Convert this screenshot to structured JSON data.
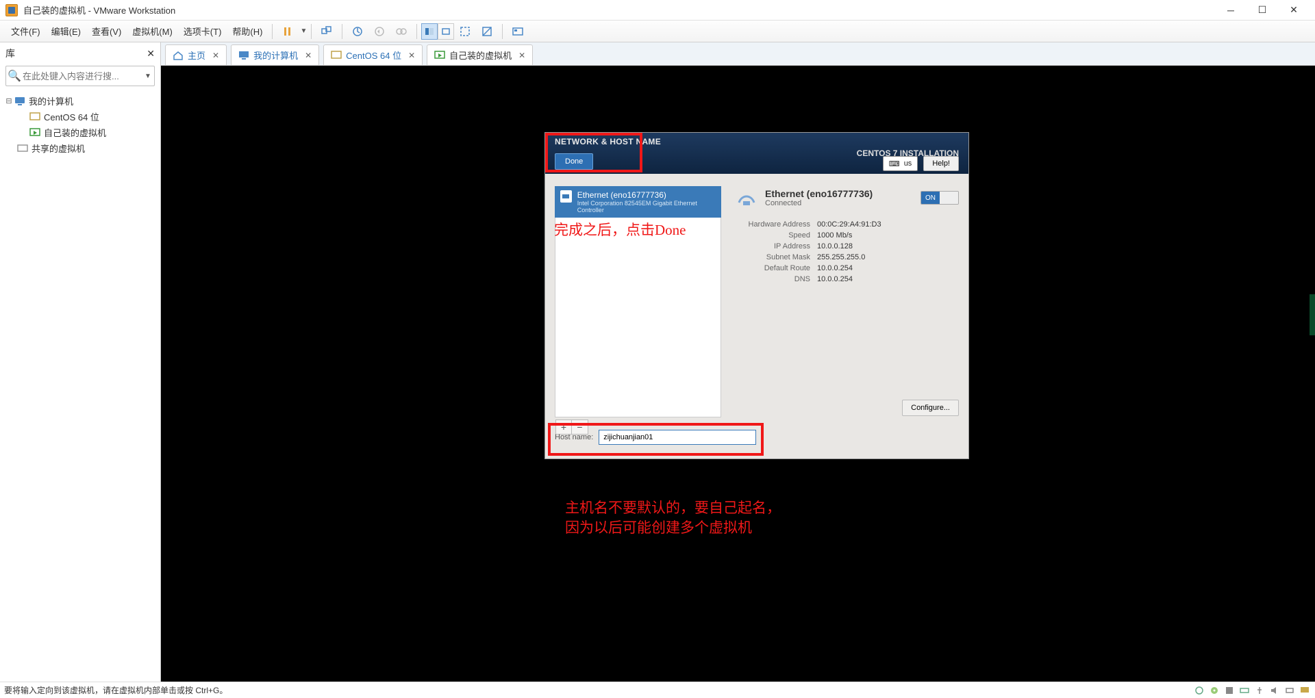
{
  "titlebar": {
    "title": "自己装的虚拟机 - VMware Workstation"
  },
  "menu": {
    "file": "文件(F)",
    "edit": "编辑(E)",
    "view": "查看(V)",
    "vm": "虚拟机(M)",
    "tabs": "选项卡(T)",
    "help": "帮助(H)"
  },
  "sidebar": {
    "header": "库",
    "search_placeholder": "在此处键入内容进行搜...",
    "tree": {
      "root": "我的计算机",
      "child1": "CentOS 64 位",
      "child2": "自己装的虚拟机",
      "shared": "共享的虚拟机"
    }
  },
  "tabs": [
    {
      "label": "主页",
      "icon": "home"
    },
    {
      "label": "我的计算机",
      "icon": "monitor"
    },
    {
      "label": "CentOS 64 位",
      "icon": "vm"
    },
    {
      "label": "自己装的虚拟机",
      "icon": "vm-active"
    }
  ],
  "installer": {
    "title": "NETWORK & HOST NAME",
    "brand": "CENTOS 7 INSTALLATION",
    "done": "Done",
    "kb": "us",
    "help": "Help!",
    "nic": {
      "name": "Ethernet (eno16777736)",
      "vendor": "Intel Corporation 82545EM Gigabit Ethernet Controller"
    },
    "detail": {
      "title": "Ethernet (eno16777736)",
      "status": "Connected",
      "toggle": "ON",
      "kv": {
        "hw_k": "Hardware Address",
        "hw_v": "00:0C:29:A4:91:D3",
        "sp_k": "Speed",
        "sp_v": "1000 Mb/s",
        "ip_k": "IP Address",
        "ip_v": "10.0.0.128",
        "sm_k": "Subnet Mask",
        "sm_v": "255.255.255.0",
        "gw_k": "Default Route",
        "gw_v": "10.0.0.254",
        "dns_k": "DNS",
        "dns_v": "10.0.0.254"
      }
    },
    "configure": "Configure...",
    "host_label": "Host name:",
    "host_value": "zijichuanjian01"
  },
  "annotations": {
    "a1": "完成之后，点击Done",
    "a2_l1": "主机名不要默认的，要自己起名，",
    "a2_l2": "因为以后可能创建多个虚拟机"
  },
  "statusbar": "要将输入定向到该虚拟机，请在虚拟机内部单击或按 Ctrl+G。"
}
